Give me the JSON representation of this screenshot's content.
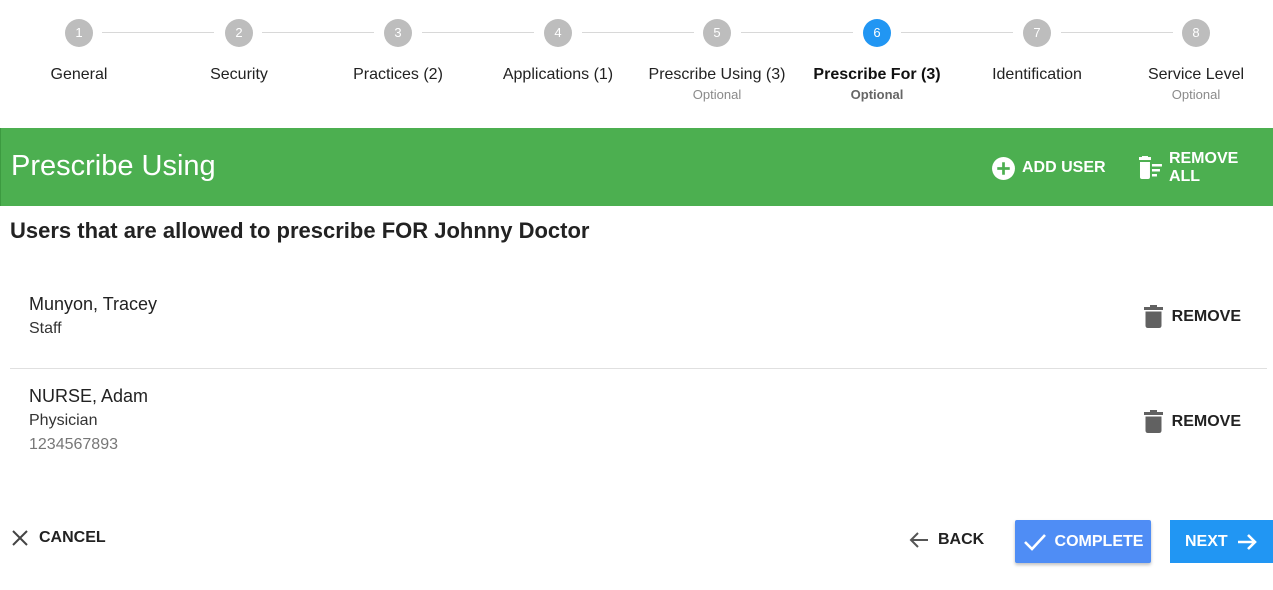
{
  "stepper": {
    "steps": [
      {
        "number": "1",
        "label": "General",
        "optional": ""
      },
      {
        "number": "2",
        "label": "Security",
        "optional": ""
      },
      {
        "number": "3",
        "label": "Practices (2)",
        "optional": ""
      },
      {
        "number": "4",
        "label": "Applications (1)",
        "optional": ""
      },
      {
        "number": "5",
        "label": "Prescribe Using (3)",
        "optional": "Optional"
      },
      {
        "number": "6",
        "label": "Prescribe For (3)",
        "optional": "Optional"
      },
      {
        "number": "7",
        "label": "Identification",
        "optional": ""
      },
      {
        "number": "8",
        "label": "Service Level",
        "optional": "Optional"
      }
    ],
    "active_step": 6
  },
  "header": {
    "title": "Prescribe Using",
    "add_user_label": "ADD USER",
    "remove_all_label": "REMOVE ALL",
    "color": "#4caf50"
  },
  "subtitle": "Users that are allowed to prescribe FOR Johnny Doctor",
  "users": [
    {
      "name": "Munyon, Tracey",
      "role": "Staff",
      "id": "",
      "remove_label": "REMOVE"
    },
    {
      "name": "NURSE, Adam",
      "role": "Physician",
      "id": "1234567893",
      "remove_label": "REMOVE"
    }
  ],
  "footer": {
    "cancel_label": "CANCEL",
    "back_label": "BACK",
    "complete_label": "COMPLETE",
    "next_label": "NEXT"
  },
  "colors": {
    "active_step": "#2196f3",
    "inactive_step": "#bdbdbd",
    "complete_button": "#4f8df5",
    "next_button": "#2196f3"
  },
  "icons": {
    "add_user": "plus-circle-icon",
    "remove_all": "delete-sweep-icon",
    "remove": "trash-icon",
    "cancel": "close-icon",
    "back": "arrow-left-icon",
    "complete": "check-icon",
    "next": "arrow-right-icon"
  }
}
